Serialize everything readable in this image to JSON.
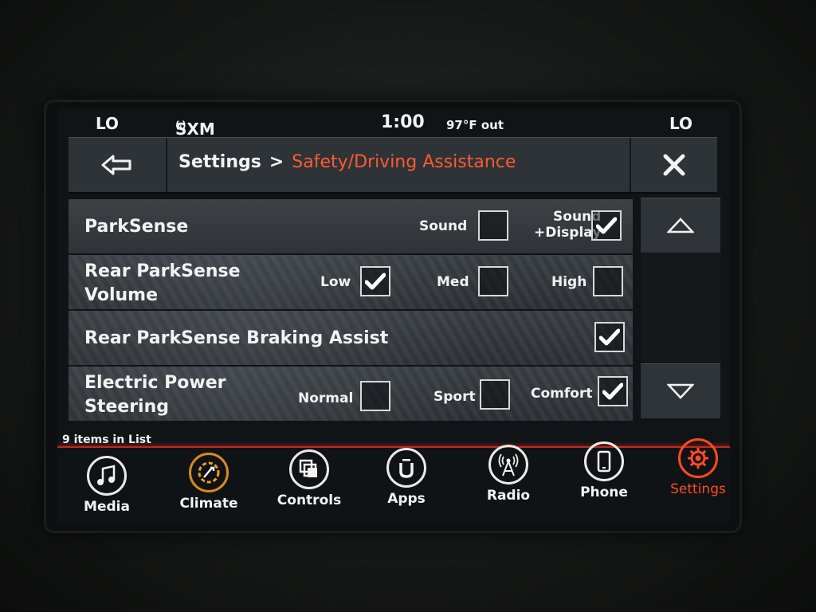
{
  "status": {
    "left_temp": "LO",
    "radio": "SXM 1",
    "time": "1:00",
    "outside_temp": "97°F out",
    "right_temp": "LO"
  },
  "header": {
    "root": "Settings",
    "separator": ">",
    "current": "Safety/Driving Assistance"
  },
  "rows": [
    {
      "label": "ParkSense",
      "options": [
        {
          "label": "Sound",
          "checked": false
        },
        {
          "label": "Sound +Display",
          "line1": "Sound",
          "line2": "+Display",
          "checked": true
        }
      ]
    },
    {
      "label_line1": "Rear ParkSense",
      "label_line2": "Volume",
      "options": [
        {
          "label": "Low",
          "checked": true
        },
        {
          "label": "Med",
          "checked": false
        },
        {
          "label": "High",
          "checked": false
        }
      ]
    },
    {
      "label": "Rear ParkSense Braking Assist",
      "options": [
        {
          "label": "",
          "checked": true
        }
      ]
    },
    {
      "label_line1": "Electric Power",
      "label_line2": "Steering",
      "options": [
        {
          "label": "Normal",
          "checked": false
        },
        {
          "label": "Sport",
          "checked": false
        },
        {
          "label": "Comfort",
          "checked": true
        }
      ]
    }
  ],
  "list_count": "9 items in List",
  "dock": [
    {
      "label": "Media",
      "icon": "music-note-icon"
    },
    {
      "label": "Climate",
      "icon": "climate-icon"
    },
    {
      "label": "Controls",
      "icon": "controls-icon"
    },
    {
      "label": "Apps",
      "icon": "apps-icon"
    },
    {
      "label": "Radio",
      "icon": "radio-tower-icon"
    },
    {
      "label": "Phone",
      "icon": "phone-icon"
    },
    {
      "label": "Settings",
      "icon": "gear-icon",
      "active": true
    }
  ],
  "colors": {
    "accent": "#ff5a2e",
    "divider": "#c0281e",
    "climate_ring": "#f0a020"
  }
}
